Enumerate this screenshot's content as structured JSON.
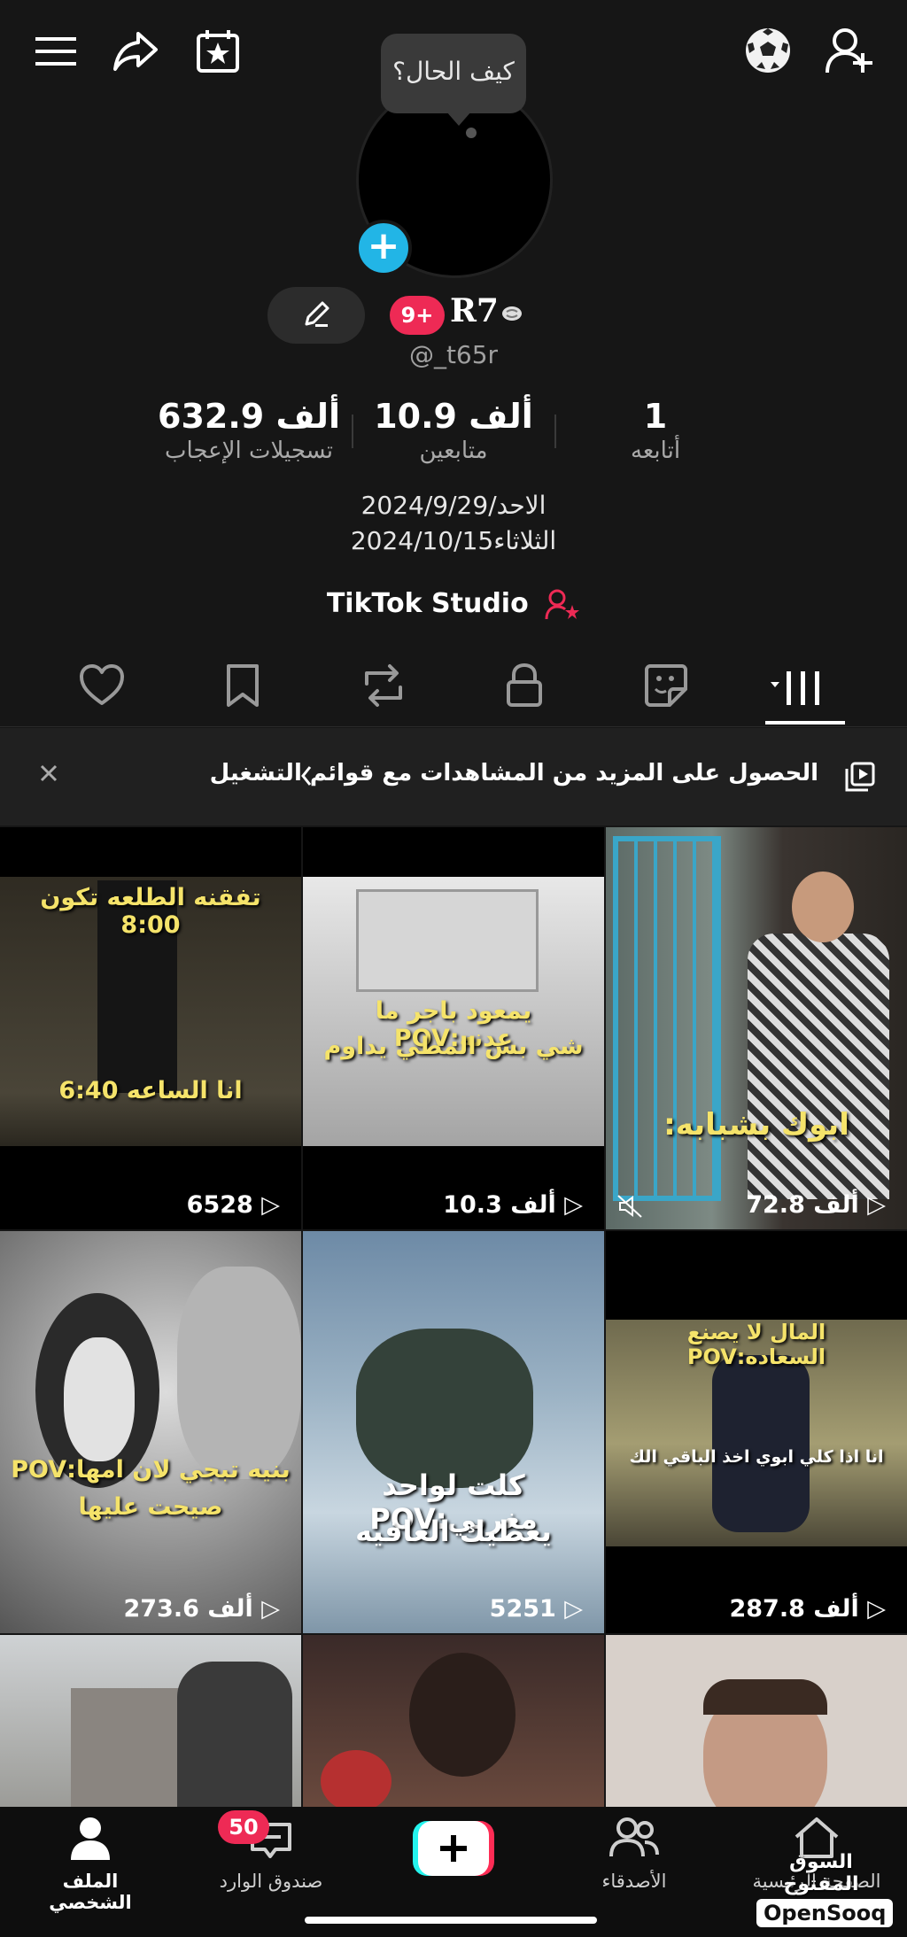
{
  "top": {
    "bubble_text": "كيف الحال؟"
  },
  "profile": {
    "badge": "9+",
    "name": "R7",
    "handle": "@_t65r"
  },
  "stats": [
    {
      "num": "632.9 ألف",
      "label": "تسجيلات الإعجاب"
    },
    {
      "num": "10.9 ألف",
      "label": "متابعين"
    },
    {
      "num": "1",
      "label": "أتابعه"
    }
  ],
  "bio": {
    "line1": "الاحد/2024/9/29",
    "line2": "الثلاثاء2024/10/15"
  },
  "studio": {
    "label": "TikTok Studio"
  },
  "banner": {
    "text": "الحصول على المزيد من المشاهدات مع قوائم التشغيل"
  },
  "videos": [
    {
      "views": "6528",
      "cap1": "تفقنه الطلعه تكون 8:00",
      "cap2": "انا الساعه 6:40"
    },
    {
      "views": "10.3 ألف",
      "cap1": "يمعود باجر ما عدنه:POV",
      "cap2": "شي بس المطي يداوم"
    },
    {
      "views": "72.8 ألف",
      "cap1": "ابوك بشبابه:"
    },
    {
      "views": "273.6 ألف",
      "cap1": "بنيه تبجي لان امها:POV",
      "cap2": "صيحت عليها"
    },
    {
      "views": "5251",
      "cap1": "كلت لواحد مغربي:POV",
      "cap2": "يعطيك العافيه"
    },
    {
      "views": "287.8 ألف",
      "cap1": "المال لا يصنع السعاده:POV",
      "cap2": "انا اذا كلي ابوي اخذ الباقي الك"
    }
  ],
  "nav": {
    "profile": "الملف الشخصي",
    "inbox": "صندوق الوارد",
    "inbox_badge": "50",
    "friends": "الأصدقاء",
    "home": "الصفحة الرئيسية"
  },
  "watermark": {
    "ar": "السوق المفتوح",
    "en": "OpenSooq"
  },
  "colors": {
    "accent": "#ee2a55",
    "cyan": "#22b5e6",
    "caption": "#f5e36a"
  }
}
